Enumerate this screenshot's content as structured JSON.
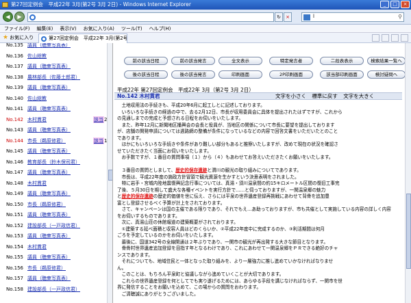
{
  "window": {
    "title": "第27回定例会　平成22年 3月(第2号 3月 2日) - Windows Internet Explorer"
  },
  "address_bar": {
    "value": "",
    "search_value": "l"
  },
  "menu": [
    "ファイル(F)",
    "編集(E)",
    "表示(V)",
    "お気に入り(A)",
    "ツール(T)",
    "ヘルプ(H)"
  ],
  "favorites_label": "お気に入り",
  "tab_title": "第27回定例会　平成22年 3月(第2号 3月 2日)",
  "left_list": [
    {
      "no": "No.135",
      "name": "議員（聴衆写真表）"
    },
    {
      "no": "No.136",
      "name": "佐山総教"
    },
    {
      "no": "No.137",
      "name": "議員（聴衆写真表）"
    },
    {
      "no": "No.138",
      "name": "農林部長（佐藤土郎君）"
    },
    {
      "no": "No.139",
      "name": "議員（聴衆写真表）"
    },
    {
      "no": "No.140",
      "name": "佐山総教"
    },
    {
      "no": "No.141",
      "name": "議員（聴衆写真表）"
    },
    {
      "no": "No.142",
      "name": "木村貫君",
      "mark": "該当",
      "count": "2",
      "current": true
    },
    {
      "no": "No.143",
      "name": "議員（聴衆写真表）"
    },
    {
      "no": "No.144",
      "name": "市長（鵜原修君）",
      "mark": "該当",
      "count": "1",
      "current": true
    },
    {
      "no": "No.145",
      "name": "議員（聴衆写真表）"
    },
    {
      "no": "No.146",
      "name": "教育部長（鈴木保司君）"
    },
    {
      "no": "No.147",
      "name": "議員（聴衆写真表）"
    },
    {
      "no": "No.148",
      "name": "木村貫君"
    },
    {
      "no": "No.149",
      "name": "議員（聴衆写真表）"
    },
    {
      "no": "No.150",
      "name": "市長（鵜原修君）"
    },
    {
      "no": "No.151",
      "name": "議員（聴衆写真表）"
    },
    {
      "no": "No.152",
      "name": "建設部長（一戸政信君）"
    },
    {
      "no": "No.153",
      "name": "議員（聴衆写真表）"
    },
    {
      "no": "No.154",
      "name": "木村貫君"
    },
    {
      "no": "No.155",
      "name": "議員（聴衆写真表）"
    },
    {
      "no": "No.156",
      "name": "市長（鵜原修君）"
    },
    {
      "no": "No.157",
      "name": "議員（聴衆写真表）"
    },
    {
      "no": "No.158",
      "name": "建設部長（一戸政信君）"
    }
  ],
  "nav_buttons": {
    "row1": [
      "前の該当日程",
      "前の該当発言",
      "全文表示",
      "特定発言者",
      "二段表表示",
      "検索結果一覧へ"
    ],
    "row2": [
      "後の該当日程",
      "後の該当発言",
      "印刷画面",
      "2P印刷画面",
      "該当部印刷画面",
      "検討疑問へ"
    ]
  },
  "meeting_title": "平成22年 第27回定例会　平成22年 3月（第2号 3月 2日）",
  "speaker": "No.142 木村貫君",
  "font_controls": [
    "文字を小さく",
    "標準に戻す",
    "文字を大きく"
  ],
  "speech": [
    "　土地収用法の手続きも、平成20年6月に起工しとに記述しております。",
    "　いろいろな手続きの経過の中で、去る2月12日、市長が収用委員会に具体を提出されたはずですが、これから",
    "の見通しまでの完成と予想される日程をお伺いをいたします。",
    "　また、昨年12月に新聞地区播興会の会長と役員が、当地区の関係について市長に要望を提出しております",
    "が、店舗の関発申請については週路網の整備が条件になっているなどの内容で回答文書をいただいたとのこと",
    "であります。",
    "　ほかにもいろいろな手続きや条件があり難しい部分もあると推察いたしますが、改めて現在の状況を確認さ",
    "せていただきたく当面にお伺いをいたします。",
    "　お手数ですが、１番目の質問事項（１）から（４）もあわせてお答えいただきたくお願いをいたします。",
    "",
    "　３番目の質問としまして、[[歴史的保存遺跡]]と渭川の観光の取り組みについてであります。",
    "　市長は、平成22年度の施政方針冒頭で観光資源を生かすという決意表明をされました。",
    "　特に岩手・宮城内陸地震復興記念行事については、真湯・須川温泉間の約15キロメートル区間の復旧工事完",
    "了後、５月30日を期して盛大な各種イベントを実行方針で……と伺っておりますが、一関温泉郷の魅力",
    "と[[歴史的保存遺跡]]の歴史的価値を世に伝え、さらには平泉の世界遺産登録再挑戦にあわせて背骨を追加豊",
    "富とし登録させるべく予算が計上をされております。",
    "　さて、キャンペーンは国の主催である限りであり、それでもえ…あ助っておりますが、市も共催として実施している内容の詳しく内容",
    "をお伺いするものであります。",
    "　次に、真湯山荘の休館報道の建築概要がされております。",
    "　①建築する延べ面積と収容人員はどのくらいか、②平成22年度中に完成するのか、③利活期間は何月",
    "ごろを予定しているのかをお伺いをいたします。",
    "　最後に、国道342号の全線開通は２年ぶりであり、一関市の観光が再出発する大きな節目となります。",
    "　骨骨村世界遺産追加登録を目指す年となるわけであり、これにあわせて一関温泉郷をＰＲできる絶好のチャ",
    "ンスであります。",
    "　それについても、地域住民と一体となった取り組みを、より一層強力に推し進めていかなければなりませ",
    "ん。",
    "　このことは、もちろん平泉町と協議しながら進めていくことが大切であります。",
    "　これらの世界遺産登録を何としてでも実り遂げるためには、あらゆる手段を講じなければならず、一関市を世",
    "界に発信することをお願いを込めて、この場からの質問をおわります。",
    "　ご清聴誠にありがとうございました。"
  ]
}
